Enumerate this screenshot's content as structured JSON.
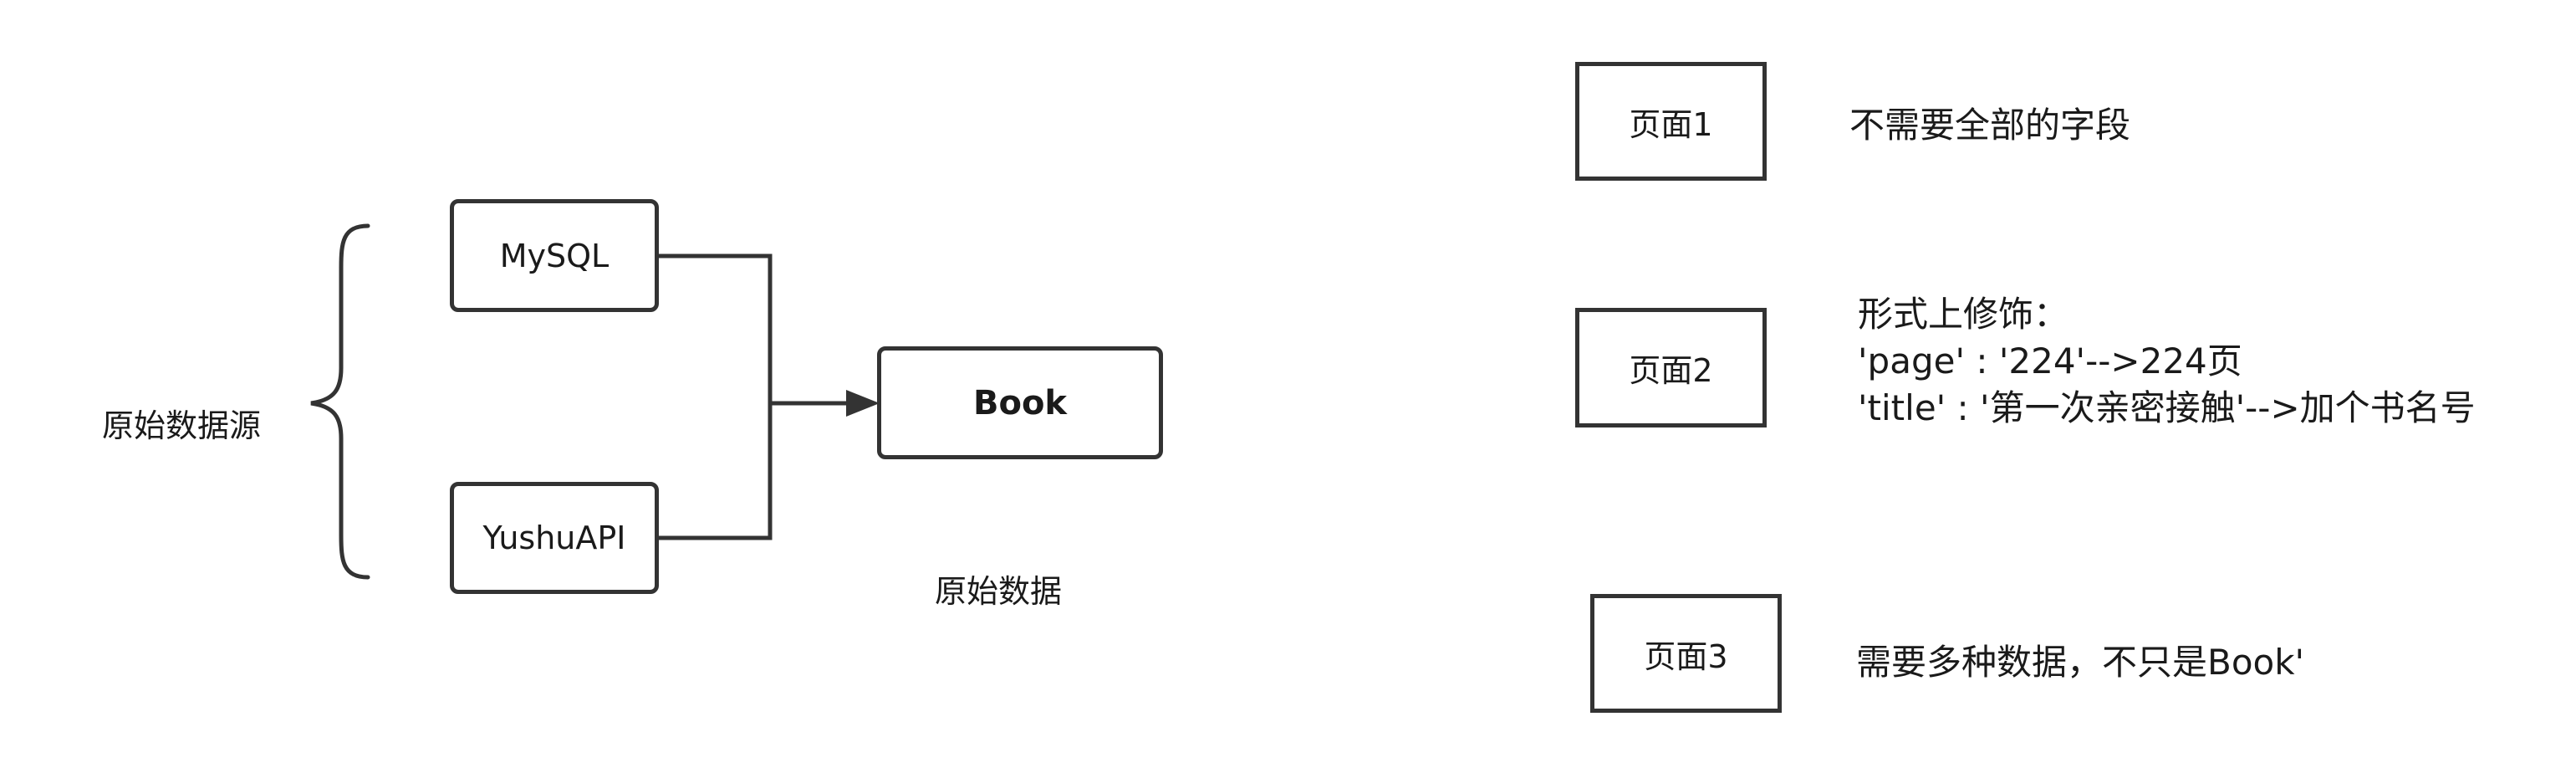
{
  "left": {
    "source_label": "原始数据源",
    "mysql": "MySQL",
    "yushu": "YushuAPI",
    "book": "Book",
    "raw_data_label": "原始数据"
  },
  "pages": [
    {
      "box_label": "页面1",
      "note_lines": [
        "不需要全部的字段"
      ]
    },
    {
      "box_label": "页面2",
      "note_lines": [
        "形式上修饰：",
        "'page' : '224'-->224页",
        "'title' : '第一次亲密接触'-->加个书名号"
      ]
    },
    {
      "box_label": "页面3",
      "note_lines": [
        "需要多种数据，不只是Book'"
      ]
    }
  ],
  "colors": {
    "stroke": "#333333",
    "text": "#1a1a1a"
  }
}
